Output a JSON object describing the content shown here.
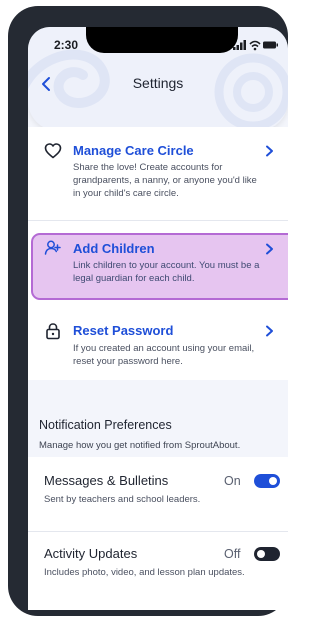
{
  "status_bar": {
    "time": "2:30"
  },
  "header": {
    "title": "Settings",
    "back_icon": "chevron-left-icon"
  },
  "account_items": [
    {
      "title": "Manage Care Circle",
      "description": "Share the love! Create accounts for grandparents, a nanny, or anyone you'd like in your child's care circle.",
      "icon": "heart-icon"
    },
    {
      "title": "Add Children",
      "description": "Link children to your account. You must be a legal guardian for each child.",
      "icon": "add-person-icon",
      "highlighted": true
    },
    {
      "title": "Reset Password",
      "description": "If you created an account using your email, reset your password here.",
      "icon": "lock-icon"
    }
  ],
  "notifications": {
    "title": "Notification Preferences",
    "subtitle": "Manage how you get notified from SproutAbout.",
    "items": [
      {
        "title": "Messages & Bulletins",
        "description": "Sent by teachers and school leaders.",
        "state": "On",
        "enabled": true
      },
      {
        "title": "Activity Updates",
        "description": "Includes photo, video, and lesson plan updates.",
        "state": "Off",
        "enabled": false
      }
    ]
  },
  "colors": {
    "accent": "#1f4fd8",
    "highlight_fill": "#e6c5f0",
    "highlight_border": "#b46ad4",
    "toggle_on": "#1f4fd8",
    "toggle_off": "#1f2430",
    "device_frame": "#252a33"
  }
}
